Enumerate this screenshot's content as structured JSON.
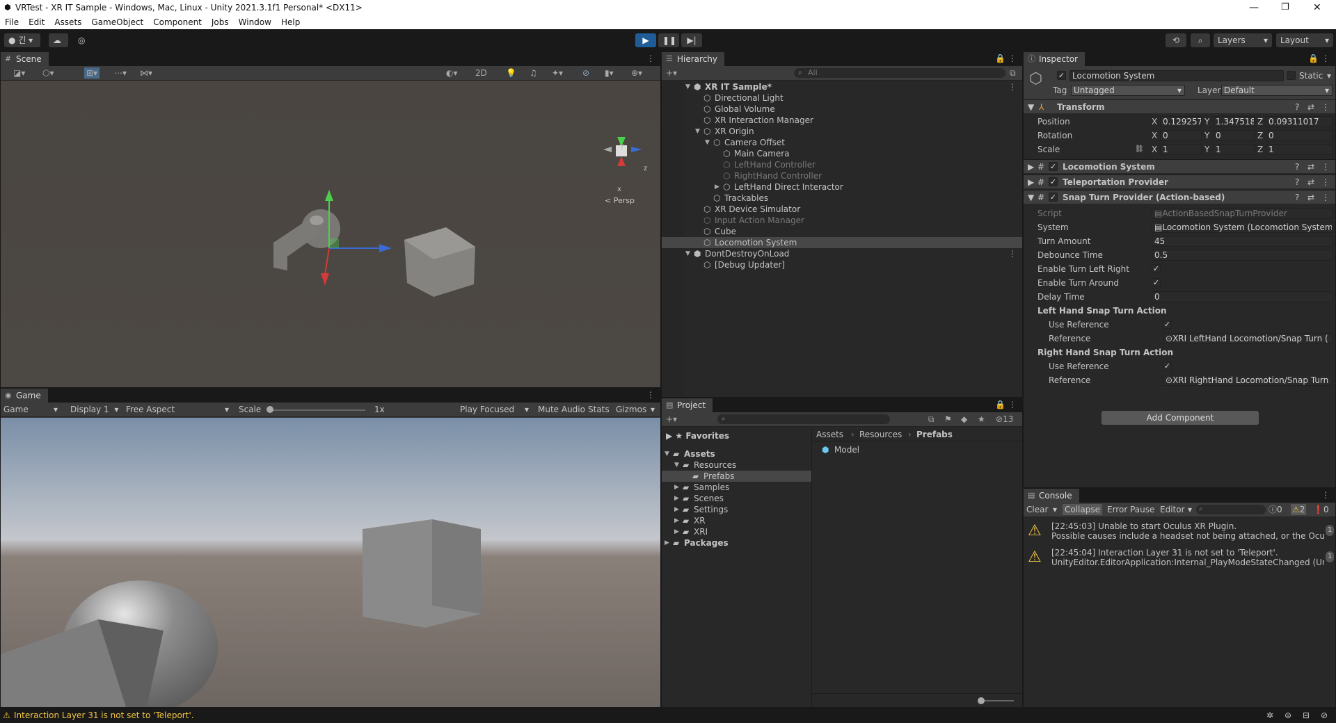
{
  "window": {
    "title": "VRTest - XR IT Sample - Windows, Mac, Linux - Unity 2021.3.1f1 Personal* <DX11>"
  },
  "menu": [
    "File",
    "Edit",
    "Assets",
    "GameObject",
    "Component",
    "Jobs",
    "Window",
    "Help"
  ],
  "toolbar": {
    "layers": "Layers",
    "layout": "Layout",
    "account": "긴"
  },
  "scene": {
    "tab": "Scene",
    "mode_2d": "2D",
    "persp": "Persp",
    "gizmo_y": "y",
    "gizmo_z": "z",
    "gizmo_x": "x"
  },
  "game": {
    "tab": "Game",
    "view": "Game",
    "display": "Display 1",
    "aspect": "Free Aspect",
    "scale_label": "Scale",
    "scale_value": "1x",
    "play_focused": "Play Focused",
    "mute": "Mute Audio",
    "stats": "Stats",
    "gizmos": "Gizmos"
  },
  "hierarchy": {
    "tab": "Hierarchy",
    "search_placeholder": "All",
    "items": [
      {
        "label": "XR IT Sample*",
        "depth": 0,
        "dim": false,
        "bold": true,
        "arrow": "▼",
        "icon": "unity-scene"
      },
      {
        "label": "Directional Light",
        "depth": 1,
        "dim": false,
        "arrow": "",
        "icon": "cube"
      },
      {
        "label": "Global Volume",
        "depth": 1,
        "dim": false,
        "arrow": "",
        "icon": "cube"
      },
      {
        "label": "XR Interaction Manager",
        "depth": 1,
        "dim": false,
        "arrow": "",
        "icon": "cube"
      },
      {
        "label": "XR Origin",
        "depth": 1,
        "dim": false,
        "arrow": "▼",
        "icon": "cube"
      },
      {
        "label": "Camera Offset",
        "depth": 2,
        "dim": false,
        "arrow": "▼",
        "icon": "cube"
      },
      {
        "label": "Main Camera",
        "depth": 3,
        "dim": false,
        "arrow": "",
        "icon": "cube"
      },
      {
        "label": "LeftHand Controller",
        "depth": 3,
        "dim": true,
        "arrow": "",
        "icon": "cube"
      },
      {
        "label": "RightHand Controller",
        "depth": 3,
        "dim": true,
        "arrow": "",
        "icon": "cube"
      },
      {
        "label": "LeftHand Direct Interactor",
        "depth": 3,
        "dim": false,
        "arrow": "▶",
        "icon": "cube"
      },
      {
        "label": "Trackables",
        "depth": 2,
        "dim": false,
        "arrow": "",
        "icon": "cube"
      },
      {
        "label": "XR Device Simulator",
        "depth": 1,
        "dim": false,
        "arrow": "",
        "icon": "cube"
      },
      {
        "label": "Input Action Manager",
        "depth": 1,
        "dim": true,
        "arrow": "",
        "icon": "cube"
      },
      {
        "label": "Cube",
        "depth": 1,
        "dim": false,
        "arrow": "",
        "icon": "cube"
      },
      {
        "label": "Locomotion System",
        "depth": 1,
        "dim": false,
        "arrow": "",
        "icon": "cube",
        "selected": true
      },
      {
        "label": "DontDestroyOnLoad",
        "depth": 0,
        "dim": false,
        "arrow": "▼",
        "icon": "unity-scene"
      },
      {
        "label": "[Debug Updater]",
        "depth": 1,
        "dim": false,
        "arrow": "",
        "icon": "cube"
      }
    ]
  },
  "project": {
    "tab": "Project",
    "badge": "13",
    "favorites": "Favorites",
    "tree": [
      {
        "label": "Assets",
        "depth": 0,
        "arrow": "▼",
        "bold": true
      },
      {
        "label": "Resources",
        "depth": 1,
        "arrow": "▼"
      },
      {
        "label": "Prefabs",
        "depth": 2,
        "arrow": "",
        "selected": true
      },
      {
        "label": "Samples",
        "depth": 1,
        "arrow": "▶"
      },
      {
        "label": "Scenes",
        "depth": 1,
        "arrow": "▶"
      },
      {
        "label": "Settings",
        "depth": 1,
        "arrow": "▶"
      },
      {
        "label": "XR",
        "depth": 1,
        "arrow": "▶"
      },
      {
        "label": "XRI",
        "depth": 1,
        "arrow": "▶"
      },
      {
        "label": "Packages",
        "depth": 0,
        "arrow": "▶",
        "bold": true
      }
    ],
    "breadcrumb": [
      "Assets",
      "Resources",
      "Prefabs"
    ],
    "files": [
      "Model"
    ]
  },
  "inspector": {
    "tab": "Inspector",
    "object_name": "Locomotion System",
    "static": "Static",
    "tag_label": "Tag",
    "tag": "Untagged",
    "layer_label": "Layer",
    "layer": "Default",
    "transform": {
      "title": "Transform",
      "position": {
        "label": "Position",
        "x": "0.1292576",
        "y": "1.347518",
        "z": "0.09311017"
      },
      "rotation": {
        "label": "Rotation",
        "x": "0",
        "y": "0",
        "z": "0"
      },
      "scale": {
        "label": "Scale",
        "x": "1",
        "y": "1",
        "z": "1"
      }
    },
    "components": [
      "Locomotion System",
      "Teleportation Provider",
      "Snap Turn Provider (Action-based)"
    ],
    "snap": {
      "script_label": "Script",
      "script": "ActionBasedSnapTurnProvider",
      "system_label": "System",
      "system": "Locomotion System (Locomotion System",
      "turn_amount_label": "Turn Amount",
      "turn_amount": "45",
      "debounce_label": "Debounce Time",
      "debounce": "0.5",
      "enable_lr_label": "Enable Turn Left Right",
      "enable_around_label": "Enable Turn Around",
      "delay_label": "Delay Time",
      "delay": "0",
      "left_header": "Left Hand Snap Turn Action",
      "use_ref": "Use Reference",
      "ref_label": "Reference",
      "left_ref": "XRI LeftHand Locomotion/Snap Turn (",
      "right_header": "Right Hand Snap Turn Action",
      "right_ref": "XRI RightHand Locomotion/Snap Turn"
    },
    "add_component": "Add Component"
  },
  "console": {
    "tab": "Console",
    "clear": "Clear",
    "collapse": "Collapse",
    "error_pause": "Error Pause",
    "editor": "Editor",
    "count_info": "0",
    "count_warn": "2",
    "count_err": "0",
    "messages": [
      {
        "line1": "[22:45:03] Unable to start Oculus XR Plugin.",
        "line2": "Possible causes include a headset not being attached, or the Oculus runti",
        "count": "1"
      },
      {
        "line1": "[22:45:04] Interaction Layer 31 is not set to 'Teleport'.",
        "line2": "UnityEditor.EditorApplication:Internal_PlayModeStateChanged (UnityEdito",
        "count": "1"
      }
    ]
  },
  "statusbar": {
    "message": "Interaction Layer 31 is not set to 'Teleport'."
  },
  "colors": {
    "selection": "#2c5d87",
    "panel": "#282828",
    "header": "#3c3c3c",
    "accent_play": "#4a8fd4",
    "warning": "#f4c542"
  }
}
